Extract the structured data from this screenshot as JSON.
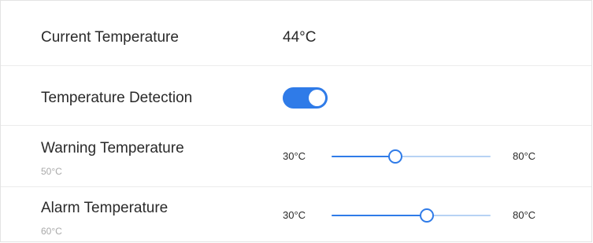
{
  "current_temperature": {
    "label": "Current Temperature",
    "value": "44°C"
  },
  "temperature_detection": {
    "label": "Temperature Detection",
    "enabled": true
  },
  "warning_temperature": {
    "label": "Warning Temperature",
    "value_text": "50°C",
    "min_label": "30°C",
    "max_label": "80°C",
    "min": 30,
    "max": 80,
    "value": 50
  },
  "alarm_temperature": {
    "label": "Alarm Temperature",
    "value_text": "60°C",
    "min_label": "30°C",
    "max_label": "80°C",
    "min": 30,
    "max": 80,
    "value": 60
  },
  "colors": {
    "accent": "#2f7be8",
    "track": "#b7d2f4"
  }
}
